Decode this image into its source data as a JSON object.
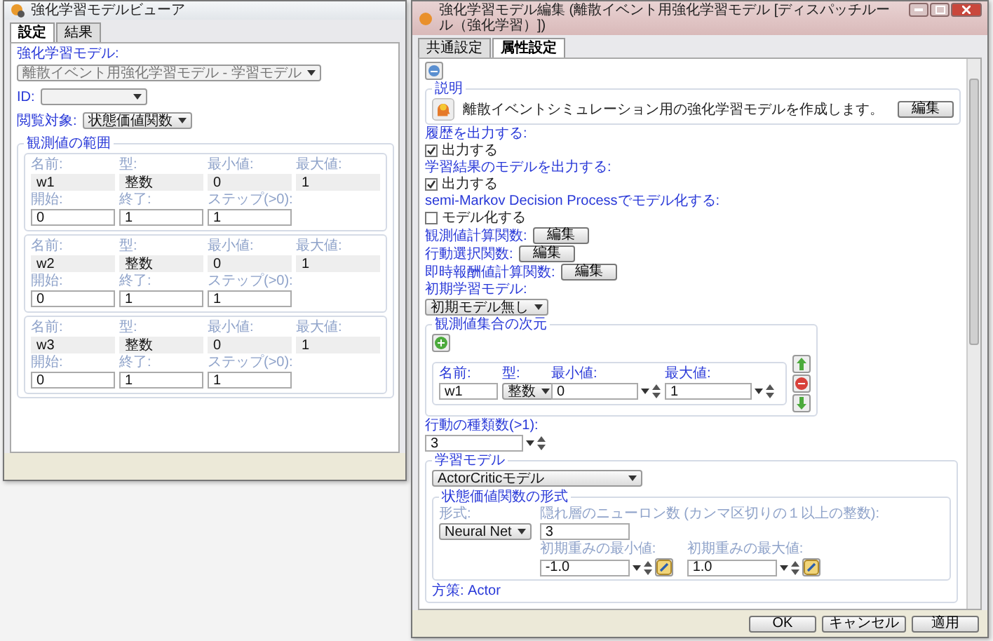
{
  "viewer_window": {
    "title": "強化学習モデルビューア",
    "tabs": [
      {
        "label": "設定",
        "selected": true
      },
      {
        "label": "結果",
        "selected": false
      }
    ],
    "model_field": {
      "label": "強化学習モデル:",
      "value": "離散イベント用強化学習モデル - 学習モデル",
      "disabled": true
    },
    "id_field": {
      "label": "ID:"
    },
    "target_field": {
      "label": "閲覧対象:",
      "value": "状態価値関数"
    },
    "range_group": {
      "title": "観測値の範囲",
      "items": [
        {
          "name_label": "名前:",
          "name": "w1",
          "type_label": "型:",
          "type": "整数",
          "min_label": "最小値:",
          "min": "0",
          "max_label": "最大値:",
          "max": "1",
          "start_label": "開始:",
          "start": "0",
          "end_label": "終了:",
          "end": "1",
          "step_label": "ステップ(>0):",
          "step": "1"
        },
        {
          "name_label": "名前:",
          "name": "w2",
          "type_label": "型:",
          "type": "整数",
          "min_label": "最小値:",
          "min": "0",
          "max_label": "最大値:",
          "max": "1",
          "start_label": "開始:",
          "start": "0",
          "end_label": "終了:",
          "end": "1",
          "step_label": "ステップ(>0):",
          "step": "1"
        },
        {
          "name_label": "名前:",
          "name": "w3",
          "type_label": "型:",
          "type": "整数",
          "min_label": "最小値:",
          "min": "0",
          "max_label": "最大値:",
          "max": "1",
          "start_label": "開始:",
          "start": "0",
          "end_label": "終了:",
          "end": "1",
          "step_label": "ステップ(>0):",
          "step": "1"
        }
      ]
    }
  },
  "editor_window": {
    "title": "強化学習モデル編集 (離散イベント用強化学習モデル [ディスパッチルール（強化学習）])",
    "tabs": [
      {
        "label": "共通設定",
        "selected": false
      },
      {
        "label": "属性設定",
        "selected": true
      }
    ],
    "description": {
      "title": "説明",
      "text": "離散イベントシミュレーション用の強化学習モデルを作成します。",
      "button": "編集"
    },
    "options": [
      {
        "label": "履歴を出力する:",
        "checkbox_label": "出力する",
        "checked": true
      },
      {
        "label": "学習結果のモデルを出力する:",
        "checkbox_label": "出力する",
        "checked": true
      },
      {
        "label": "semi-Markov Decision Processでモデル化する:",
        "checkbox_label": "モデル化する",
        "checked": false
      }
    ],
    "function_rows": [
      {
        "label": "観測値計算関数:",
        "button": "編集"
      },
      {
        "label": "行動選択関数:",
        "button": "編集"
      },
      {
        "label": "即時報酬値計算関数:",
        "button": "編集"
      }
    ],
    "initial_model": {
      "label": "初期学習モデル:",
      "value": "初期モデル無し"
    },
    "dimension_group": {
      "title": "観測値集合の次元",
      "rows": [
        {
          "name_label": "名前:",
          "name": "w1",
          "type_label": "型:",
          "type": "整数",
          "min_label": "最小値:",
          "min": "0",
          "max_label": "最大値:",
          "max": "1"
        }
      ]
    },
    "action_count": {
      "label": "行動の種類数(>1):",
      "value": "3"
    },
    "learning_model": {
      "title": "学習モデル",
      "value": "ActorCriticモデル",
      "value_function": {
        "title": "状態価値関数の形式",
        "form_label": "形式:",
        "form_value": "Neural Net",
        "hidden_label": "隠れ層のニューロン数 (カンマ区切りの１以上の整数):",
        "hidden_value": "3",
        "min_label": "初期重みの最小値:",
        "min_value": "-1.0",
        "max_label": "初期重みの最大値:",
        "max_value": "1.0"
      },
      "policy_title": "方策: Actor"
    },
    "buttons": [
      "OK",
      "キャンセル",
      "適用"
    ]
  }
}
